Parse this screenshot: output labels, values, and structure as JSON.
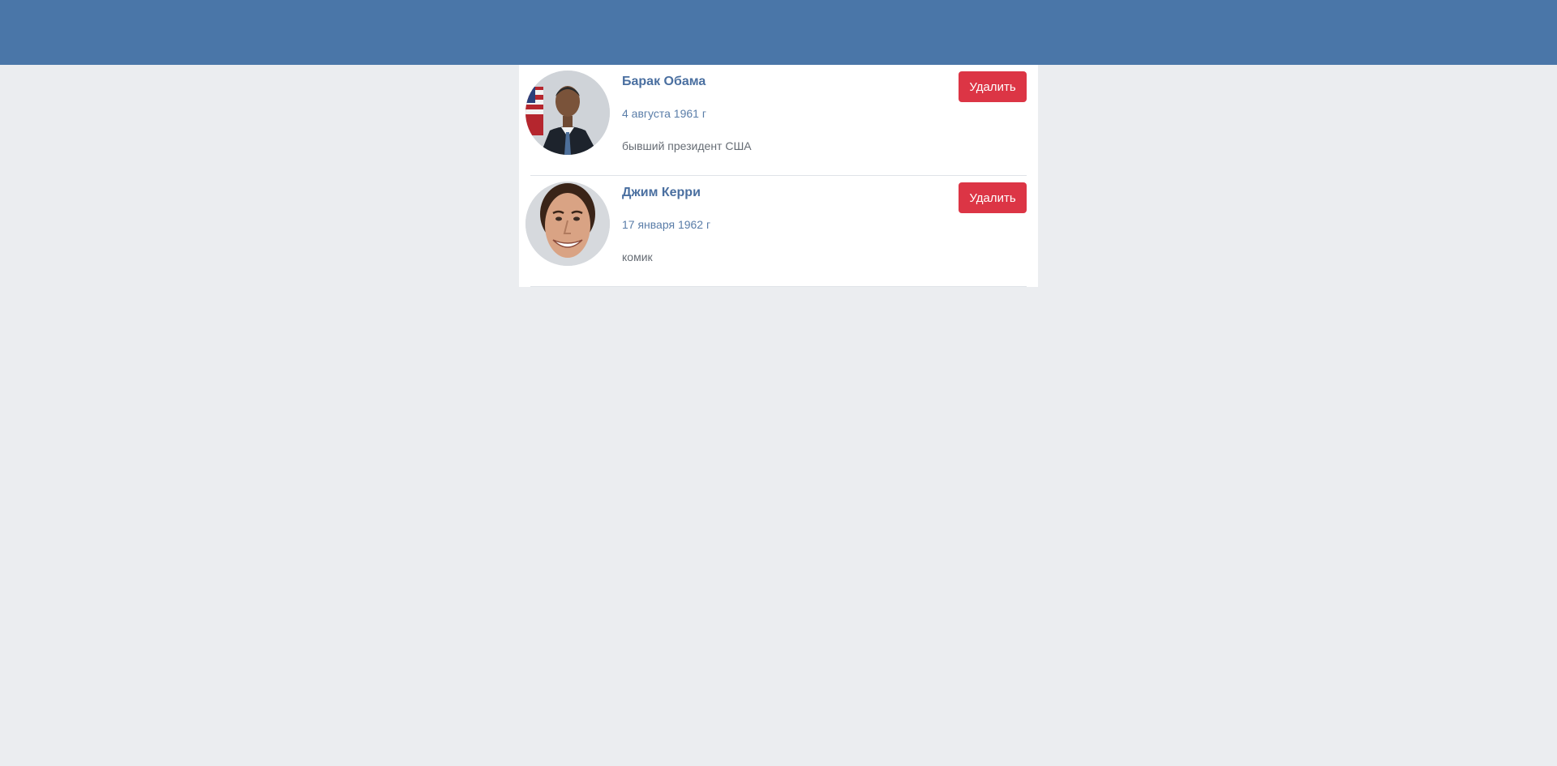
{
  "people": [
    {
      "name": "Барак Обама",
      "birth_date": "4 августа 1961 г",
      "description": "бывший президент США",
      "delete_label": "Удалить"
    },
    {
      "name": "Джим Керри",
      "birth_date": "17 января 1962 г",
      "description": "комик",
      "delete_label": "Удалить"
    }
  ],
  "colors": {
    "header": "#4a76a8",
    "background": "#ebedf0",
    "delete_button": "#dc3545",
    "name_text": "#4a6fa0"
  }
}
